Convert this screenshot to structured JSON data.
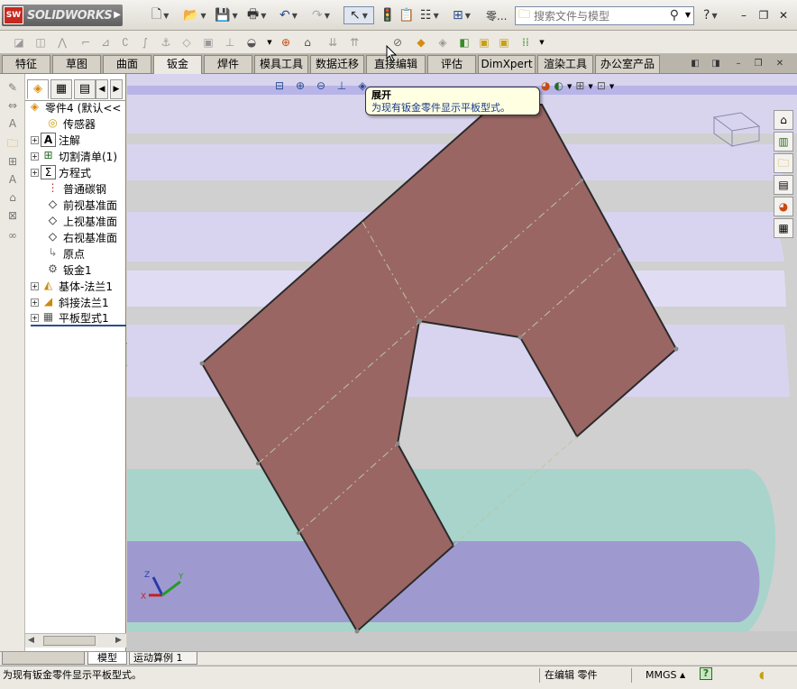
{
  "app": {
    "logo_mark": "SW",
    "logo_text": "SOLIDWORKS",
    "search_placeholder": "搜索文件与模型",
    "part_label": "零..."
  },
  "command_tabs": [
    "特征",
    "草图",
    "曲面",
    "钣金",
    "焊件",
    "模具工具",
    "数据迁移",
    "直接编辑",
    "评估",
    "DimXpert",
    "渲染工具",
    "办公室产品"
  ],
  "active_tab": "钣金",
  "feature_tree": {
    "root": "零件4",
    "root_config": "(默认<<",
    "items": [
      {
        "label": "传感器",
        "icon": "sensor-icon",
        "expandable": false
      },
      {
        "label": "注解",
        "icon": "annotation-icon",
        "expandable": true
      },
      {
        "label": "切割清单(1)",
        "icon": "cut-list-icon",
        "expandable": true
      },
      {
        "label": "方程式",
        "icon": "equation-icon",
        "expandable": true
      },
      {
        "label": "普通碳钢",
        "icon": "material-icon",
        "expandable": false
      },
      {
        "label": "前视基准面",
        "icon": "plane-icon",
        "expandable": false
      },
      {
        "label": "上视基准面",
        "icon": "plane-icon",
        "expandable": false
      },
      {
        "label": "右视基准面",
        "icon": "plane-icon",
        "expandable": false
      },
      {
        "label": "原点",
        "icon": "origin-icon",
        "expandable": false
      },
      {
        "label": "钣金1",
        "icon": "sheetmetal-icon",
        "expandable": false
      },
      {
        "label": "基体-法兰1",
        "icon": "base-flange-icon",
        "expandable": true
      },
      {
        "label": "斜接法兰1",
        "icon": "miter-flange-icon",
        "expandable": true
      },
      {
        "label": "平板型式1",
        "icon": "flat-pattern-icon",
        "expandable": true
      }
    ]
  },
  "tooltip": {
    "title": "展开",
    "description": "为现有钣金零件显示平板型式。"
  },
  "bottom_tabs": [
    "模型",
    "运动算例 1"
  ],
  "status": {
    "message": "为现有钣金零件显示平板型式。",
    "mode": "在编辑 零件",
    "units": "MMGS"
  },
  "colors": {
    "part_fill": "#9a6664",
    "band_teal": "#a8d4cc",
    "band_purple": "#9e9ad0",
    "band_lavender": "#d8d4f0",
    "bend_line": "#b8c8a0"
  }
}
